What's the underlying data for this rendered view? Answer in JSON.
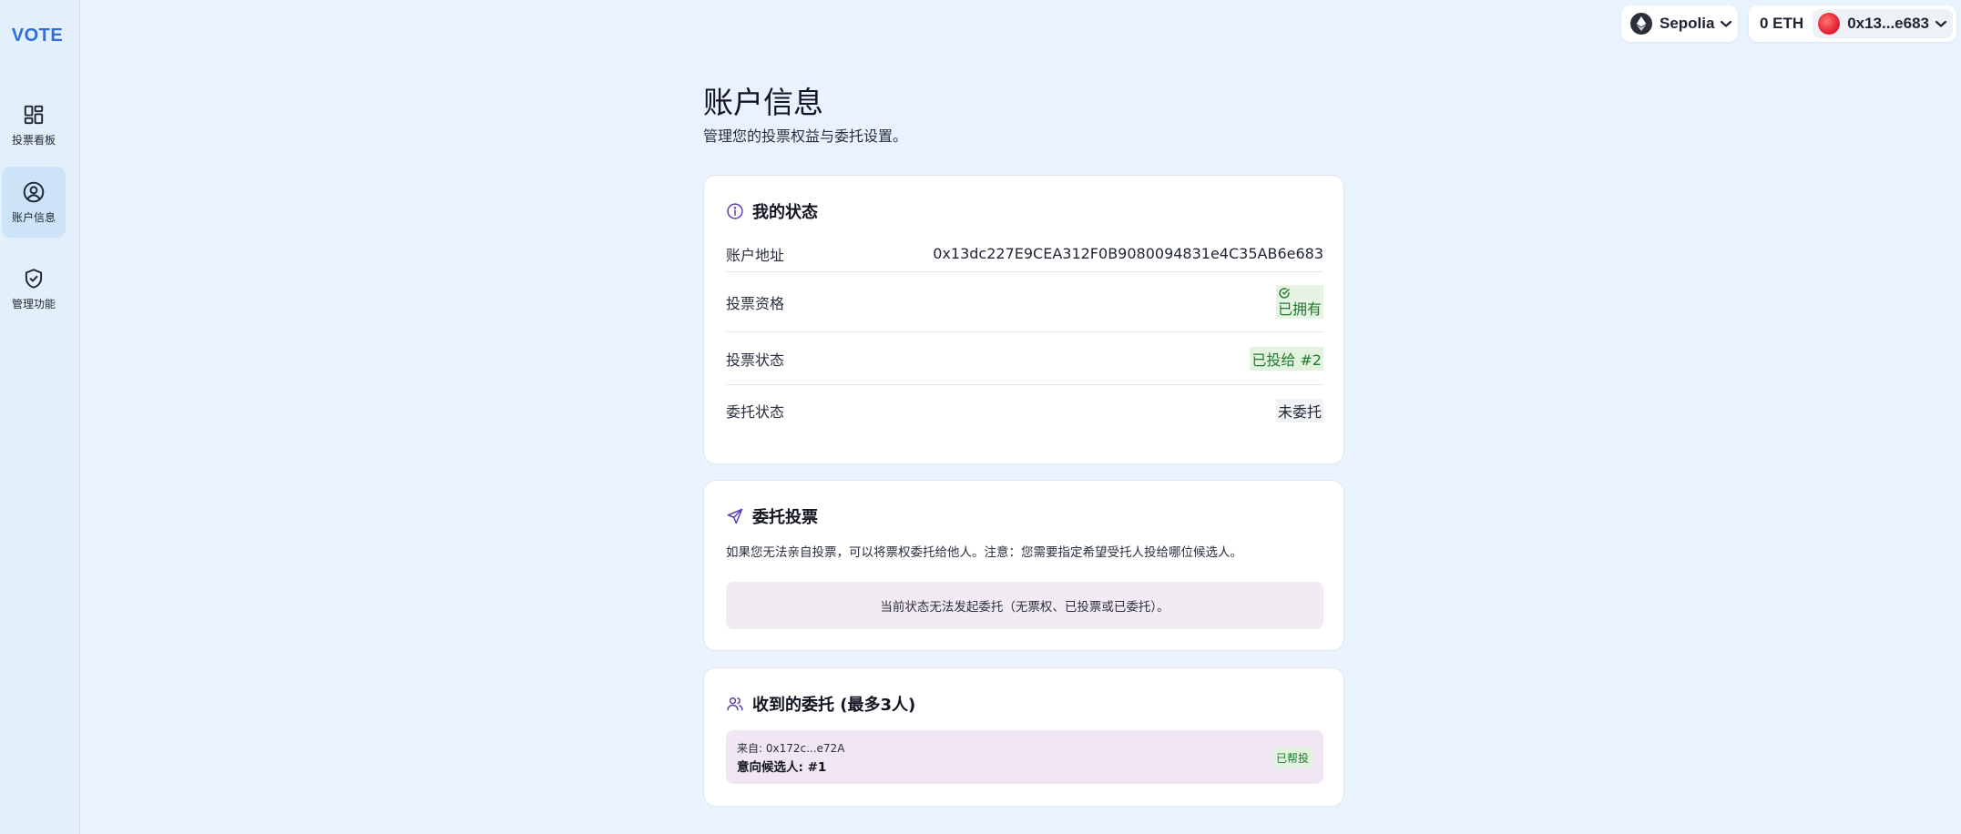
{
  "sidebar": {
    "logo": "VOTE",
    "items": [
      {
        "label": "投票看板",
        "icon": "dashboard-icon",
        "active": false
      },
      {
        "label": "账户信息",
        "icon": "user-circle-icon",
        "active": true
      },
      {
        "label": "管理功能",
        "icon": "shield-check-icon",
        "active": false
      }
    ]
  },
  "topbar": {
    "network": "Sepolia",
    "balance": "0 ETH",
    "address_short": "0x13...e683"
  },
  "page": {
    "title": "账户信息",
    "subtitle": "管理您的投票权益与委托设置。"
  },
  "status_card": {
    "title": "我的状态",
    "rows": [
      {
        "label": "账户地址",
        "value": "0x13dc227E9CEA312F0B9080094831e4C35AB6e683"
      },
      {
        "label": "投票资格",
        "value": "已拥有"
      },
      {
        "label": "投票状态",
        "value": "已投给 #2"
      },
      {
        "label": "委托状态",
        "value": "未委托"
      }
    ]
  },
  "delegate_card": {
    "title": "委托投票",
    "description": "如果您无法亲自投票，可以将票权委托给他人。注意：您需要指定希望受托人投给哪位候选人。",
    "notice": "当前状态无法发起委托（无票权、已投票或已委托）。"
  },
  "received_card": {
    "title": "收到的委托 (最多3人)",
    "items": [
      {
        "from": "来自: 0x172c...e72A",
        "candidate": "意向候选人: #1",
        "status": "已帮投"
      }
    ]
  },
  "colors": {
    "background": "#eaf3fd",
    "sidebar": "#e3f0fc",
    "accent": "#2e6fdc",
    "success": "#1e7a2e"
  }
}
